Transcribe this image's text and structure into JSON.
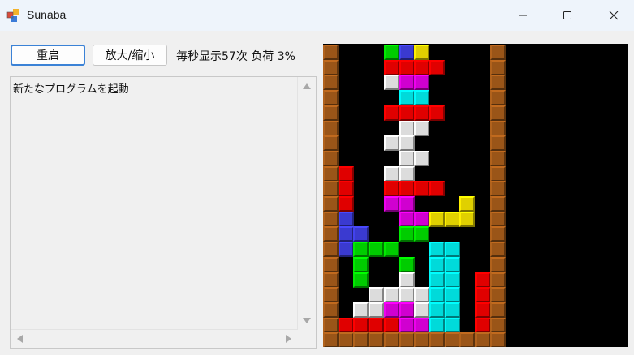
{
  "window": {
    "title": "Sunaba",
    "app_icon": "window-app-icon",
    "controls": [
      "minimize-icon",
      "maximize-icon",
      "close-icon"
    ]
  },
  "toolbar": {
    "restart_label": "重启",
    "zoom_label": "放大/缩小",
    "status": "毎秒显示57次 负荷 3%"
  },
  "log": {
    "text": "新たなプログラムを起動"
  },
  "colors": {
    "wall": "#9a5518",
    "red": "#e00000",
    "blue": "#3a3ad0",
    "yellow": "#e0d000",
    "magenta": "#d000d0",
    "cyan": "#00dada",
    "white": "#dcdcdc",
    "green": "#00cc00",
    "empty": "#000000"
  },
  "board": {
    "rows": [
      "W...GBY....W",
      "W...RRRR...W",
      "W...WMM....W",
      "W....CC....W",
      "W...RRRR...W",
      "W....WW....W",
      "W...WW.....W",
      "W....WW....W",
      "WR..WW.....W",
      "WR..RRRR...W",
      "WR..MM...Y.W",
      "WB...MMYYY.W",
      "WBB..GG....W",
      "WBGGG..CC..W",
      "W.G..G.CC..W",
      "W.G..W.CC.RW",
      "W..WWWWCC.RW",
      "W.WWMMWCC.RW",
      "WRRRRMMCC.RW",
      "WWWWWWWWWWWW"
    ]
  }
}
